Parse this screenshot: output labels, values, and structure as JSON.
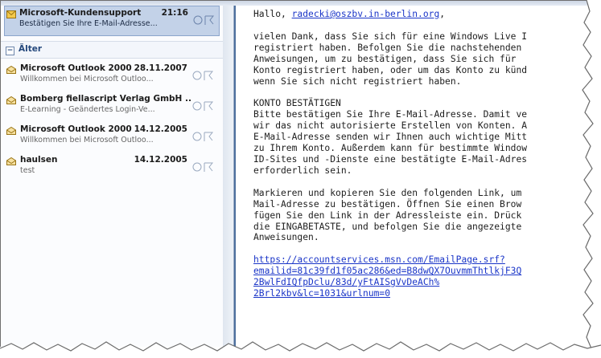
{
  "message_list": {
    "selected": {
      "from": "Microsoft-Kundensupport",
      "time": "21:16",
      "preview": "Bestätigen Sie Ihre E-Mail-Adresse..."
    },
    "group_label": "Älter",
    "items": [
      {
        "from": "Microsoft Outlook 2000",
        "time": "28.11.2007",
        "preview": "Willkommen bei Microsoft Outloo..."
      },
      {
        "from": "Bomberg fiellascript Verlag GmbH ..",
        "time": "",
        "preview": "E-Learning - Geändertes Login-Ve..."
      },
      {
        "from": "Microsoft Outlook 2000",
        "time": "14.12.2005",
        "preview": "Willkommen bei Microsoft Outloo..."
      },
      {
        "from": "haulsen",
        "time": "14.12.2005",
        "preview": "test"
      }
    ]
  },
  "reading_pane": {
    "greeting_prefix": "Hallo, ",
    "greeting_email": "radecki@oszbv.in-berlin.org",
    "greeting_suffix": ",",
    "para1": "vielen Dank, dass Sie sich für eine Windows Live I\nregistriert haben. Befolgen Sie die nachstehenden \nAnweisungen, um zu bestätigen, dass Sie sich für \nKonto registriert haben, oder um das Konto zu künd\nwenn Sie sich nicht registriert haben.",
    "para2": "KONTO BESTÄTIGEN\nBitte bestätigen Sie Ihre E-Mail-Adresse. Damit ve\nwir das nicht autorisierte Erstellen von Konten. A\nE-Mail-Adresse senden wir Ihnen auch wichtige Mitt\nzu Ihrem Konto. Außerdem kann für bestimmte Window\nID-Sites und -Dienste eine bestätigte E-Mail-Adres\nerforderlich sein.",
    "para3": "Markieren und kopieren Sie den folgenden Link, um \nMail-Adresse zu bestätigen. Öffnen Sie einen Brow\nfügen Sie den Link in der Adressleiste ein. Drück\ndie EINGABETASTE, und befolgen Sie die angezeigte\nAnweisungen.",
    "confirm_link": "https://accountservices.msn.com/EmailPage.srf?\nemailid=81c39fd1f05ac286&ed=B8dwQX7OuvmmThtlkjF3Q\n2BwlFdIQfpDclu/83d/yFtAISgVvDeACh%\n2Brl2kbv&lc=1031&urlnum=0"
  },
  "colors": {
    "selected_bg": "#c3d2e8",
    "link": "#1a35c8",
    "group_text": "#24487c"
  }
}
